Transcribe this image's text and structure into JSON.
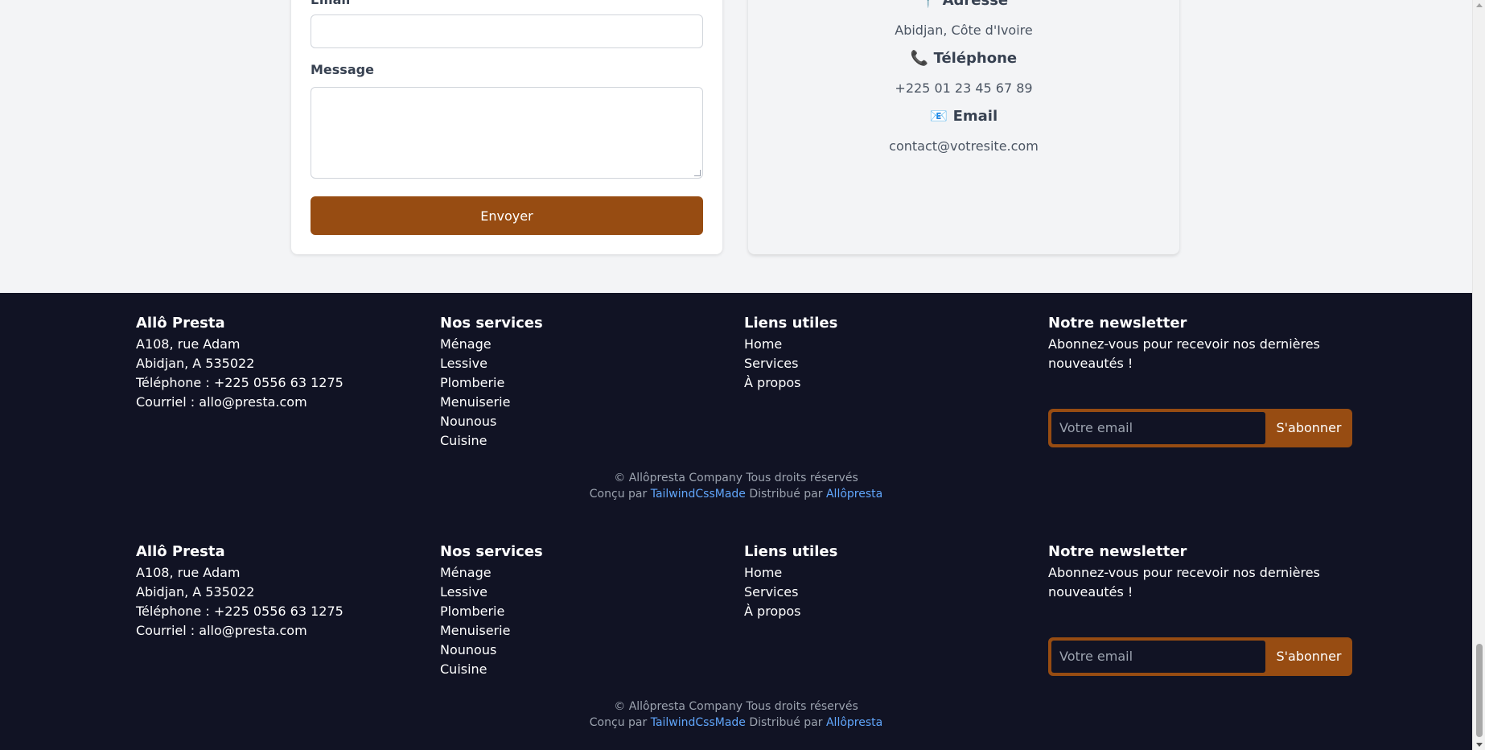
{
  "contact_form": {
    "email_label": "Email",
    "message_label": "Message",
    "send_label": "Envoyer"
  },
  "contact_info": {
    "address": {
      "icon": "📍",
      "title": "Adresse",
      "value": "Abidjan, Côte d'Ivoire"
    },
    "phone": {
      "icon": "📞",
      "title": "Téléphone",
      "value": "+225 01 23 45 67 89"
    },
    "email": {
      "icon": "📧",
      "title": "Email",
      "value": "contact@votresite.com"
    }
  },
  "footer": {
    "company": {
      "title": "Allô Presta",
      "lines": [
        "A108, rue Adam",
        "Abidjan, A 535022",
        "Téléphone : +225 0556 63 1275",
        "Courriel : allo@presta.com"
      ]
    },
    "services": {
      "title": "Nos services",
      "items": [
        "Ménage",
        "Lessive",
        "Plomberie",
        "Menuiserie",
        "Nounous",
        "Cuisine"
      ]
    },
    "links": {
      "title": "Liens utiles",
      "items": [
        "Home",
        "Services",
        "À propos"
      ]
    },
    "newsletter": {
      "title": "Notre newsletter",
      "text": "Abonnez-vous pour recevoir nos dernières nouveautés !",
      "placeholder": "Votre email",
      "button": "S'abonner"
    },
    "copyright": "© Allôpresta Company Tous droits réservés",
    "designed_by_prefix": "Conçu par",
    "designed_by_link": "TailwindCssMade",
    "distributed_by_prefix": "Distribué par",
    "distributed_by_link": "Allôpresta"
  },
  "colors": {
    "accent": "#974c12",
    "footer_bg": "#111324",
    "link": "#60a5fa"
  }
}
